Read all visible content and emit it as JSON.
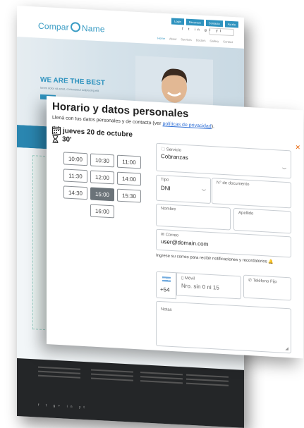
{
  "website": {
    "logo_left": "Compar",
    "logo_right": "Name",
    "top_links": [
      "Login",
      "Recursos",
      "Contacto",
      "Ayuda"
    ],
    "social_icons": "f t in g+ yt",
    "nav_items": [
      "Home",
      "About",
      "Services",
      "Doctors",
      "Gallery",
      "Contact"
    ],
    "hero_title": "WE ARE THE BEST",
    "hero_subtitle": "lorem dolor sit amet, consectetur adipiscing elit",
    "footer_icons": "f t g+ in yt"
  },
  "form": {
    "title": "Horario y datos personales",
    "subtitle_before": "Llená con tus datos personales y de contacto (ver ",
    "privacy_link": "políticas de privacidad",
    "subtitle_after": ").",
    "date": "jueves 20 de octubre",
    "duration": "30'",
    "time_slots": [
      {
        "time": "10:00",
        "selected": false
      },
      {
        "time": "10:30",
        "selected": false
      },
      {
        "time": "11:00",
        "selected": false
      },
      {
        "time": "11:30",
        "selected": false
      },
      {
        "time": "12:00",
        "selected": false
      },
      {
        "time": "14:00",
        "selected": false
      },
      {
        "time": "14:30",
        "selected": false
      },
      {
        "time": "15:00",
        "selected": true
      },
      {
        "time": "15:30",
        "selected": false
      },
      {
        "time": "16:00",
        "selected": false
      }
    ],
    "service": {
      "label": "Servicio",
      "value": "Cobranzas"
    },
    "id_type": {
      "label": "Tipo",
      "value": "DNI"
    },
    "doc_number": {
      "label": "N° de documento"
    },
    "first_name": {
      "label": "Nombre"
    },
    "last_name": {
      "label": "Apellido"
    },
    "email": {
      "label": "Correo",
      "value": "user@domain.com"
    },
    "email_hint": "Ingrese su correo para recibir notificaciones y recordatorios",
    "phone_prefix": "+54",
    "mobile": {
      "label": "Móvil",
      "placeholder": "Nro. sin 0 ni 15"
    },
    "landline": {
      "label": "Teléfono Fijo"
    },
    "notes": {
      "label": "Notas"
    }
  },
  "colors": {
    "accent": "#2f93bf",
    "selected_slot": "#6b7379",
    "link": "#2f6fd6",
    "close": "#e8670c"
  }
}
